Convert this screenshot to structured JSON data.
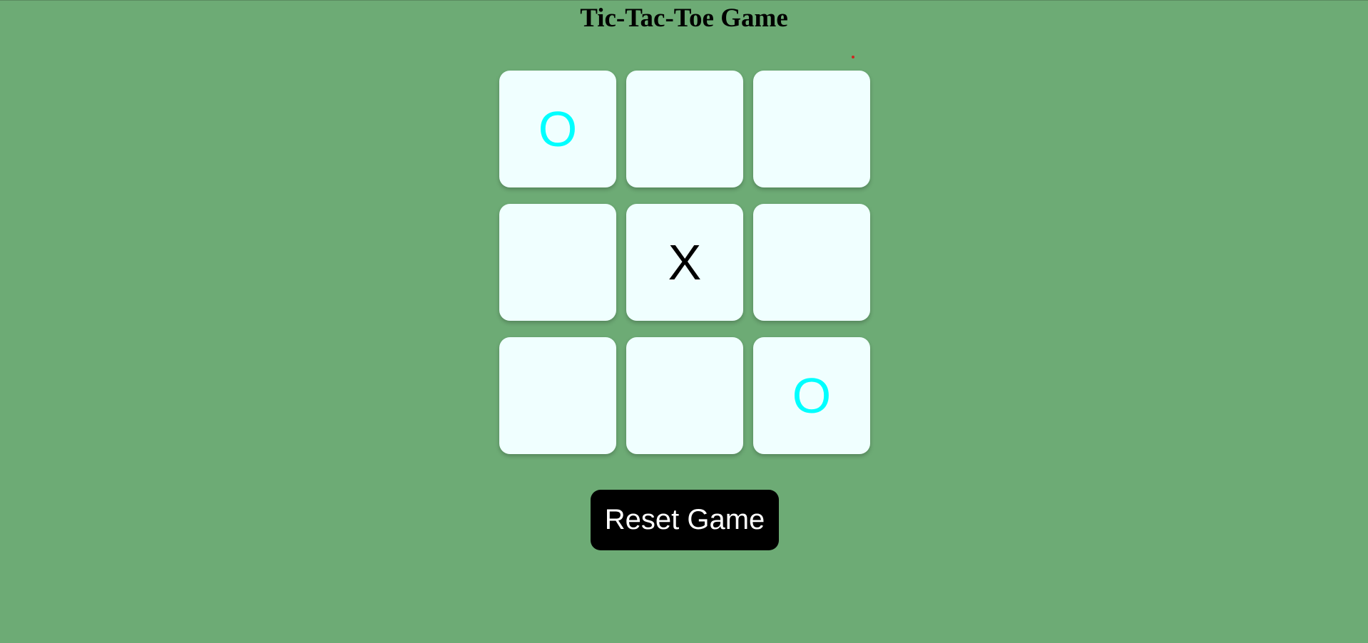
{
  "page": {
    "title": "Tic-Tac-Toe Game"
  },
  "board": {
    "cells": [
      {
        "value": "O"
      },
      {
        "value": ""
      },
      {
        "value": ""
      },
      {
        "value": ""
      },
      {
        "value": "X"
      },
      {
        "value": ""
      },
      {
        "value": ""
      },
      {
        "value": ""
      },
      {
        "value": "O"
      }
    ]
  },
  "controls": {
    "reset_label": "Reset Game"
  },
  "colors": {
    "background": "#6dab75",
    "cell_background": "#f0ffff",
    "x_mark": "#000000",
    "o_mark": "#00ffff",
    "button_background": "#000000",
    "button_text": "#ffffff"
  }
}
